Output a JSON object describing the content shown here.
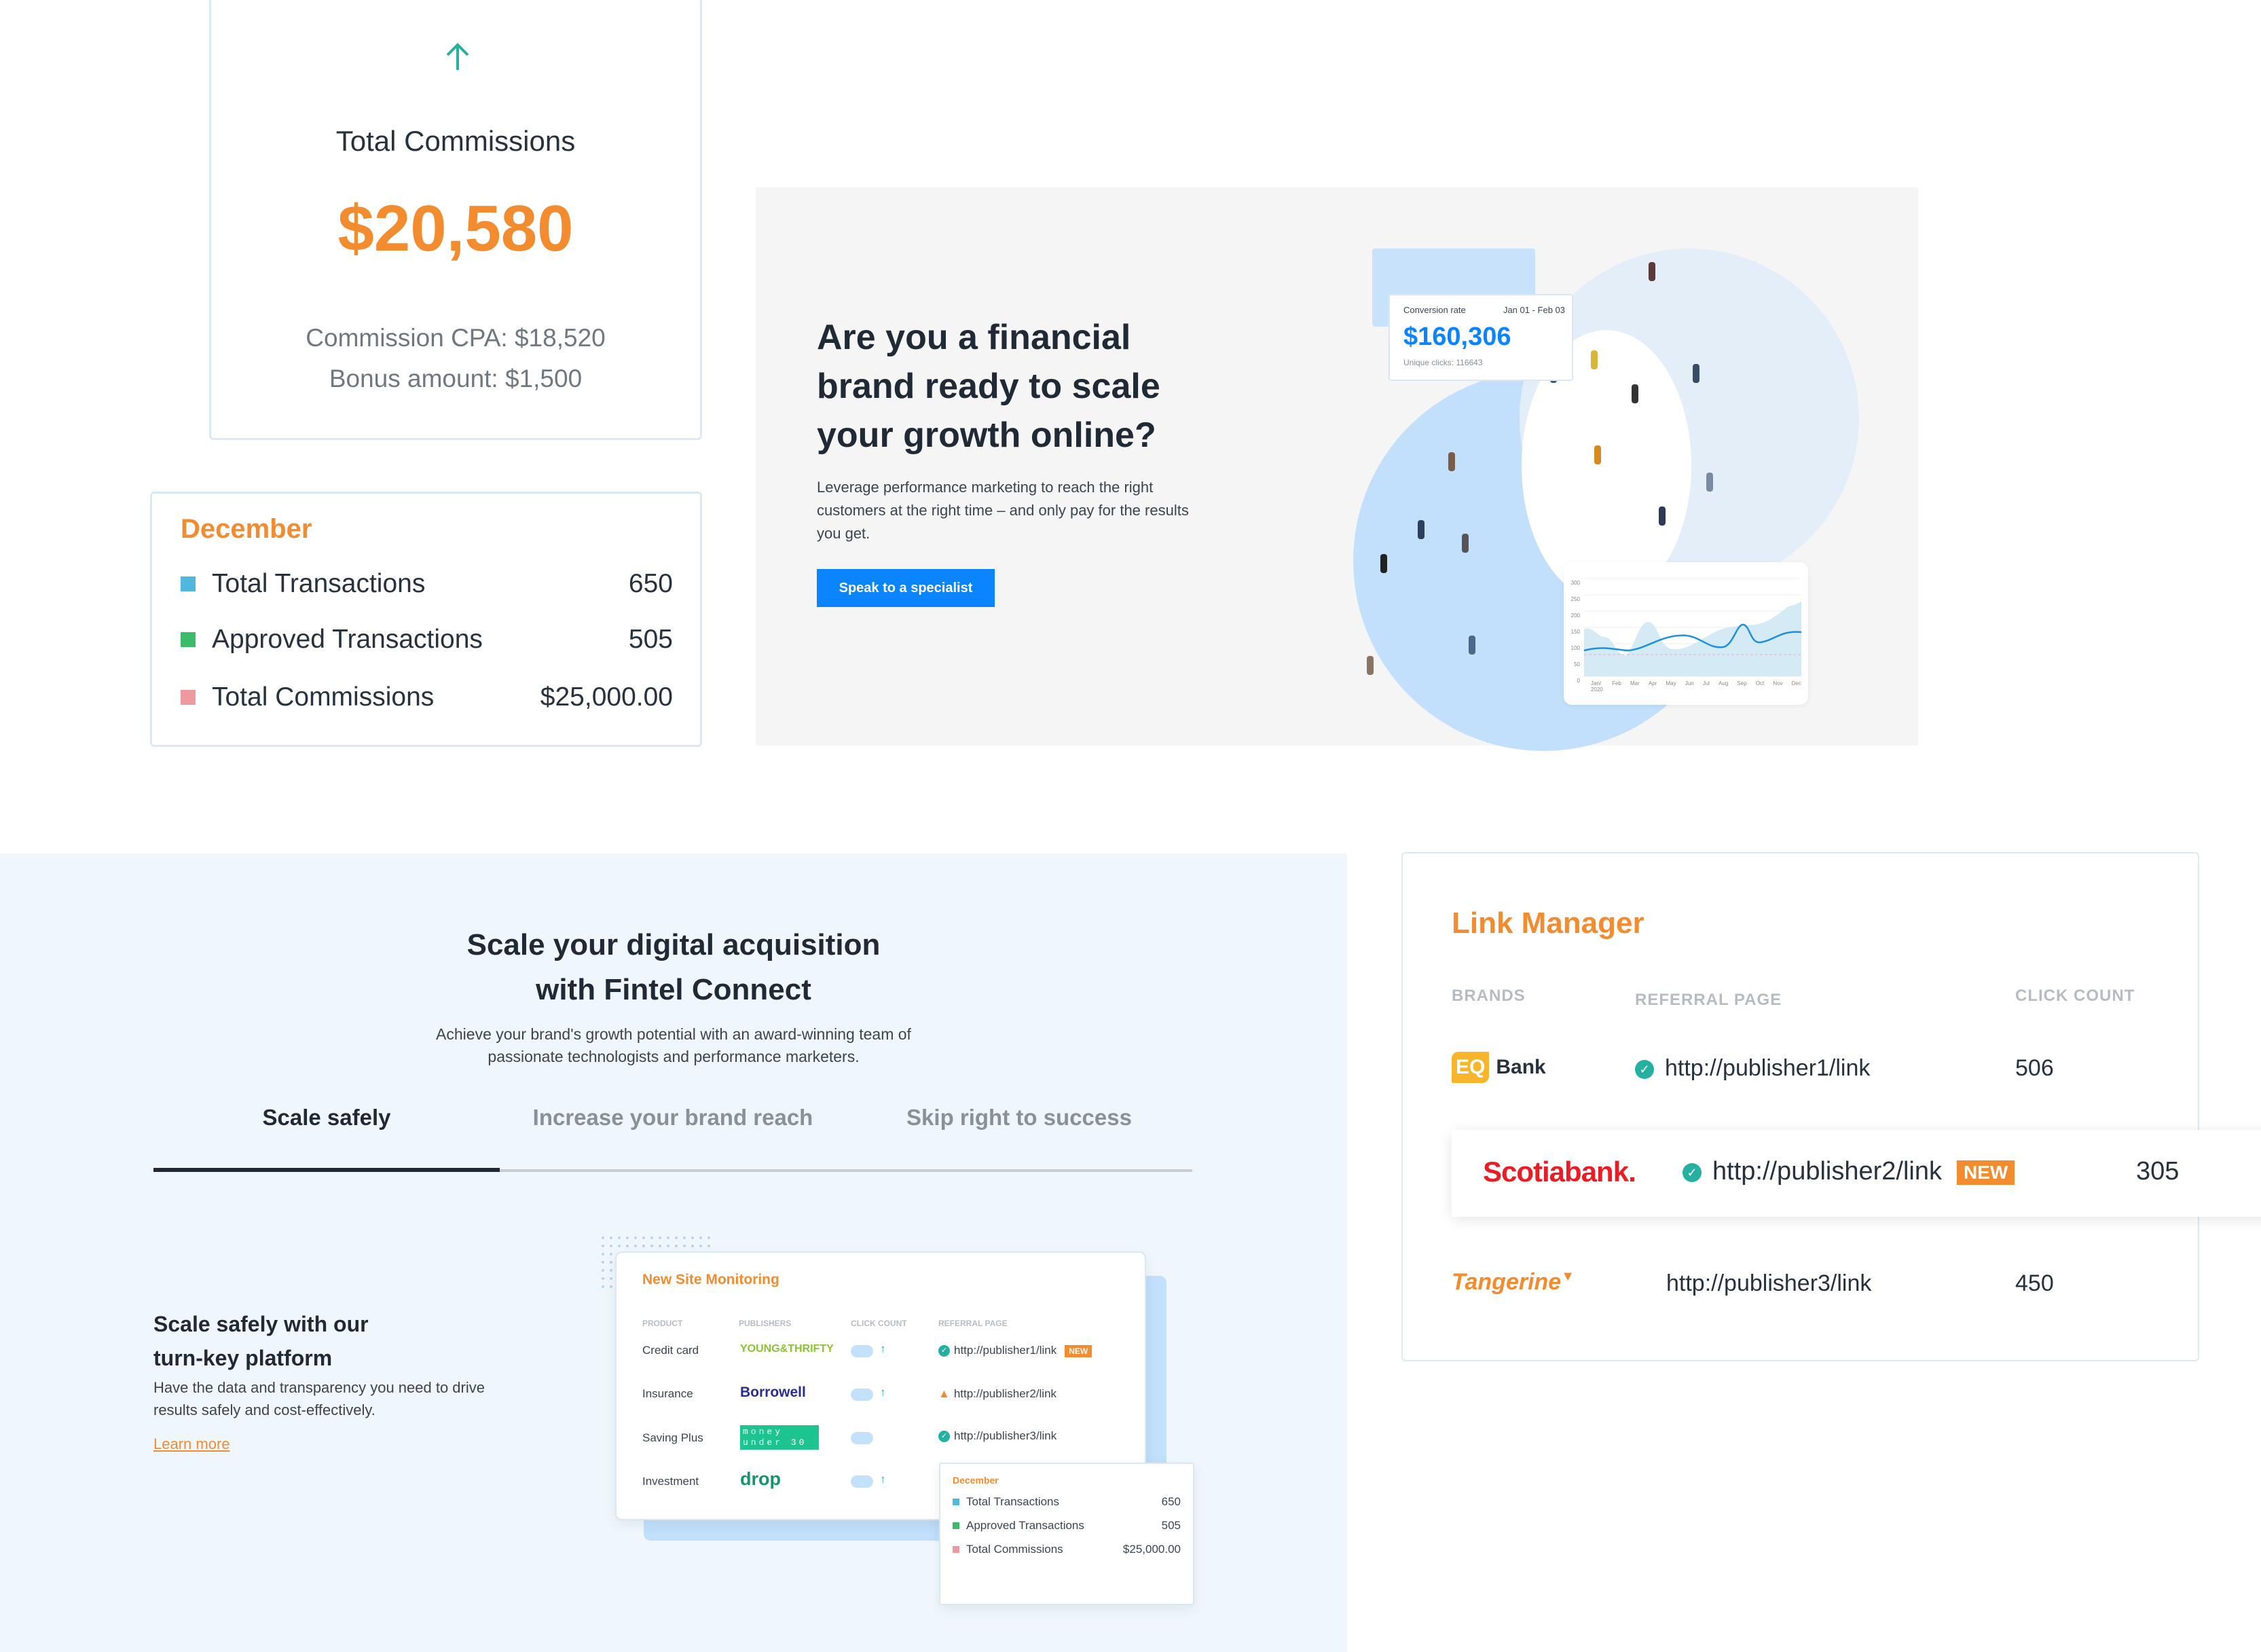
{
  "commissions_card": {
    "title": "Total Commissions",
    "amount": "$20,580",
    "cpa": "Commission CPA: $18,520",
    "bonus": "Bonus amount: $1,500",
    "icon": "arrow-up-icon"
  },
  "december_card": {
    "title": "December",
    "rows": [
      {
        "label": "Total Transactions",
        "value": "650",
        "color": "#4fb8dc"
      },
      {
        "label": "Approved Transactions",
        "value": "505",
        "color": "#3dbb6d"
      },
      {
        "label": "Total Commissions",
        "value": "$25,000.00",
        "color": "#ec9aa0"
      }
    ]
  },
  "hero": {
    "heading": "Are you a financial brand ready to scale your growth online?",
    "body": "Leverage performance marketing to reach the right customers at the right time – and only pay for the results you get.",
    "cta": "Speak to a specialist",
    "stat_card": {
      "label": "Conversion rate",
      "date_range": "Jan 01 - Feb 03",
      "value": "$160,306",
      "sub": "Unique clicks: 116643"
    },
    "mini_chart": {
      "y_ticks": [
        "300",
        "250",
        "200",
        "150",
        "100",
        "50",
        "0"
      ],
      "x_ticks": [
        "Jan/ 2020",
        "Feb",
        "Mar",
        "Apr",
        "May",
        "Jun",
        "Jul",
        "Aug",
        "Sep",
        "Oct",
        "Nov",
        "Dec"
      ]
    }
  },
  "acquisition": {
    "title_line1": "Scale your digital acquisition",
    "title_line2": "with Fintel Connect",
    "subtitle_line1": "Achieve your brand's growth potential with an award-winning team of",
    "subtitle_line2": "passionate technologists and performance marketers.",
    "tabs": [
      {
        "label": "Scale safely",
        "active": true
      },
      {
        "label": "Increase your brand reach",
        "active": false
      },
      {
        "label": "Skip right to success",
        "active": false
      }
    ],
    "feature": {
      "title_line1": "Scale safely with our",
      "title_line2": "turn-key platform",
      "body": "Have the data and transparency you need to drive results safely and cost-effectively.",
      "link": "Learn more"
    },
    "monitoring": {
      "title": "New Site Monitoring",
      "headers": [
        "PRODUCT",
        "PUBLISHERS",
        "CLICK COUNT",
        "REFERRAL PAGE"
      ],
      "rows": [
        {
          "product": "Credit card",
          "publisher": "YOUNG&THRIFTY",
          "arrow": true,
          "status": "check",
          "url": "http://publisher1/link",
          "badge": "NEW"
        },
        {
          "product": "Insurance",
          "publisher": "Borrowell",
          "arrow": true,
          "status": "warning",
          "url": "http://publisher2/link"
        },
        {
          "product": "Saving Plus",
          "publisher": "money under 30",
          "arrow": false,
          "status": "check",
          "url": "http://publisher3/link"
        },
        {
          "product": "Investment",
          "publisher": "drop",
          "arrow": true
        }
      ],
      "december": {
        "title": "December",
        "rows": [
          {
            "label": "Total Transactions",
            "value": "650"
          },
          {
            "label": "Approved Transactions",
            "value": "505"
          },
          {
            "label": "Total Commissions",
            "value": "$25,000.00"
          }
        ]
      }
    }
  },
  "link_manager": {
    "title": "Link Manager",
    "headers": [
      "BRANDS",
      "REFERRAL PAGE",
      "CLICK COUNT"
    ],
    "rows": [
      {
        "brand": "Bank",
        "logo_mark": "EQ",
        "verified": true,
        "url": "http://publisher1/link",
        "count": "506"
      },
      {
        "brand": "Scotiabank.",
        "verified": true,
        "url": "http://publisher2/link",
        "badge": "NEW",
        "count": "305"
      },
      {
        "brand": "Tangerine",
        "verified": false,
        "url": "http://publisher3/link",
        "count": "450"
      }
    ],
    "accent": "#f38b2f"
  }
}
